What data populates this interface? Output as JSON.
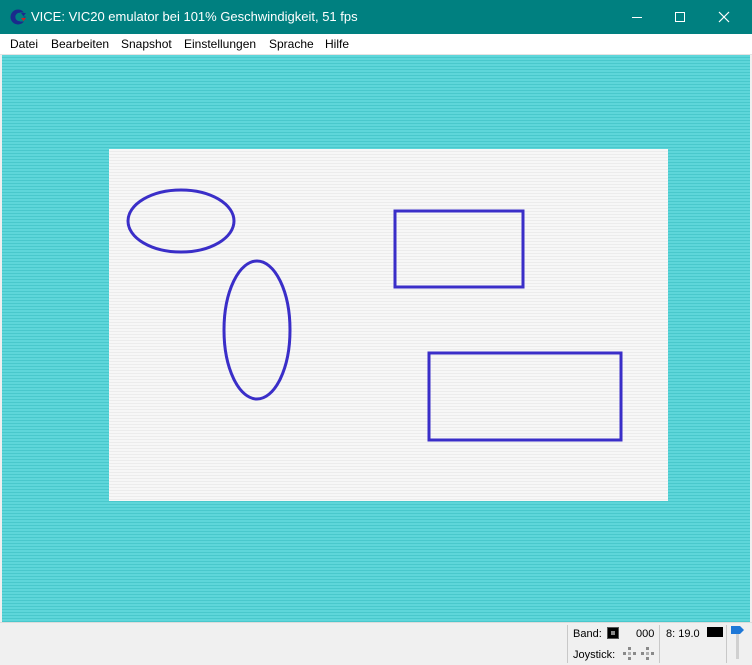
{
  "window": {
    "title": "VICE: VIC20 emulator bei 101% Geschwindigkeit, 51 fps",
    "icon": "commodore-logo-icon",
    "controls": [
      "minimize-icon",
      "maximize-icon",
      "close-icon"
    ]
  },
  "menu": {
    "items": [
      {
        "label": "Datei"
      },
      {
        "label": "Bearbeiten"
      },
      {
        "label": "Snapshot"
      },
      {
        "label": "Einstellungen"
      },
      {
        "label": "Sprache"
      },
      {
        "label": "Hilfe"
      }
    ]
  },
  "status": {
    "tape_label": "Band:",
    "tape_counter": "000",
    "drive_info": "8: 19.0",
    "joystick_label": "Joystick:"
  },
  "colors": {
    "titlebar": "#008080",
    "border": "#5ed6da",
    "screen_bg": "#f7f7f7",
    "shape_stroke": "#3a2ec8"
  }
}
